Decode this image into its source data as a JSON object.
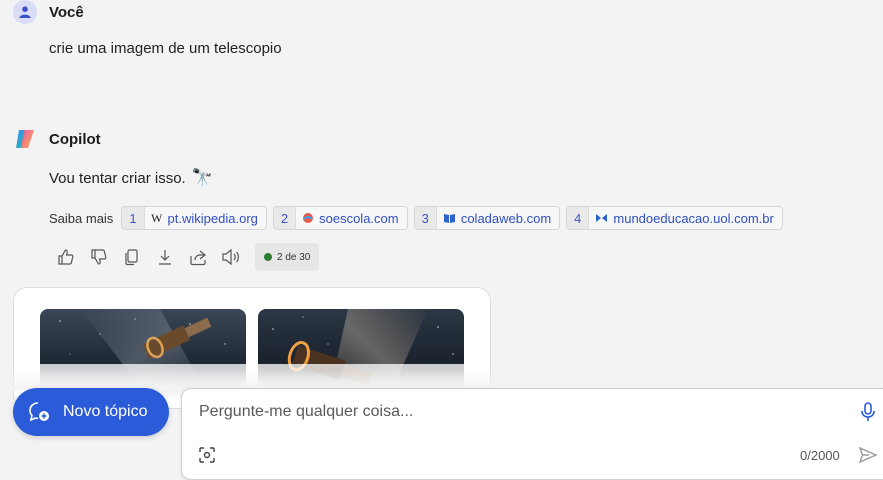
{
  "user": {
    "name": "Você",
    "message": "crie uma imagem de um telescopio"
  },
  "copilot": {
    "name": "Copilot",
    "message": "Vou tentar criar isso.",
    "emoji": "🔭"
  },
  "sources": {
    "label": "Saiba mais",
    "items": [
      {
        "num": "1",
        "domain": "pt.wikipedia.org",
        "icon": "wikipedia-icon"
      },
      {
        "num": "2",
        "domain": "soescola.com",
        "icon": "soescola-icon"
      },
      {
        "num": "3",
        "domain": "coladaweb.com",
        "icon": "coladaweb-icon"
      },
      {
        "num": "4",
        "domain": "mundoeducacao.uol.com.br",
        "icon": "mundoeducacao-icon"
      }
    ]
  },
  "counter": "2 de 30",
  "new_topic_label": "Novo tópico",
  "composer": {
    "placeholder": "Pergunte-me qualquer coisa...",
    "char_count": "0/2000"
  },
  "colors": {
    "accent": "#2b5bd8",
    "link": "#2f4fc1",
    "status": "#2e7d32"
  }
}
